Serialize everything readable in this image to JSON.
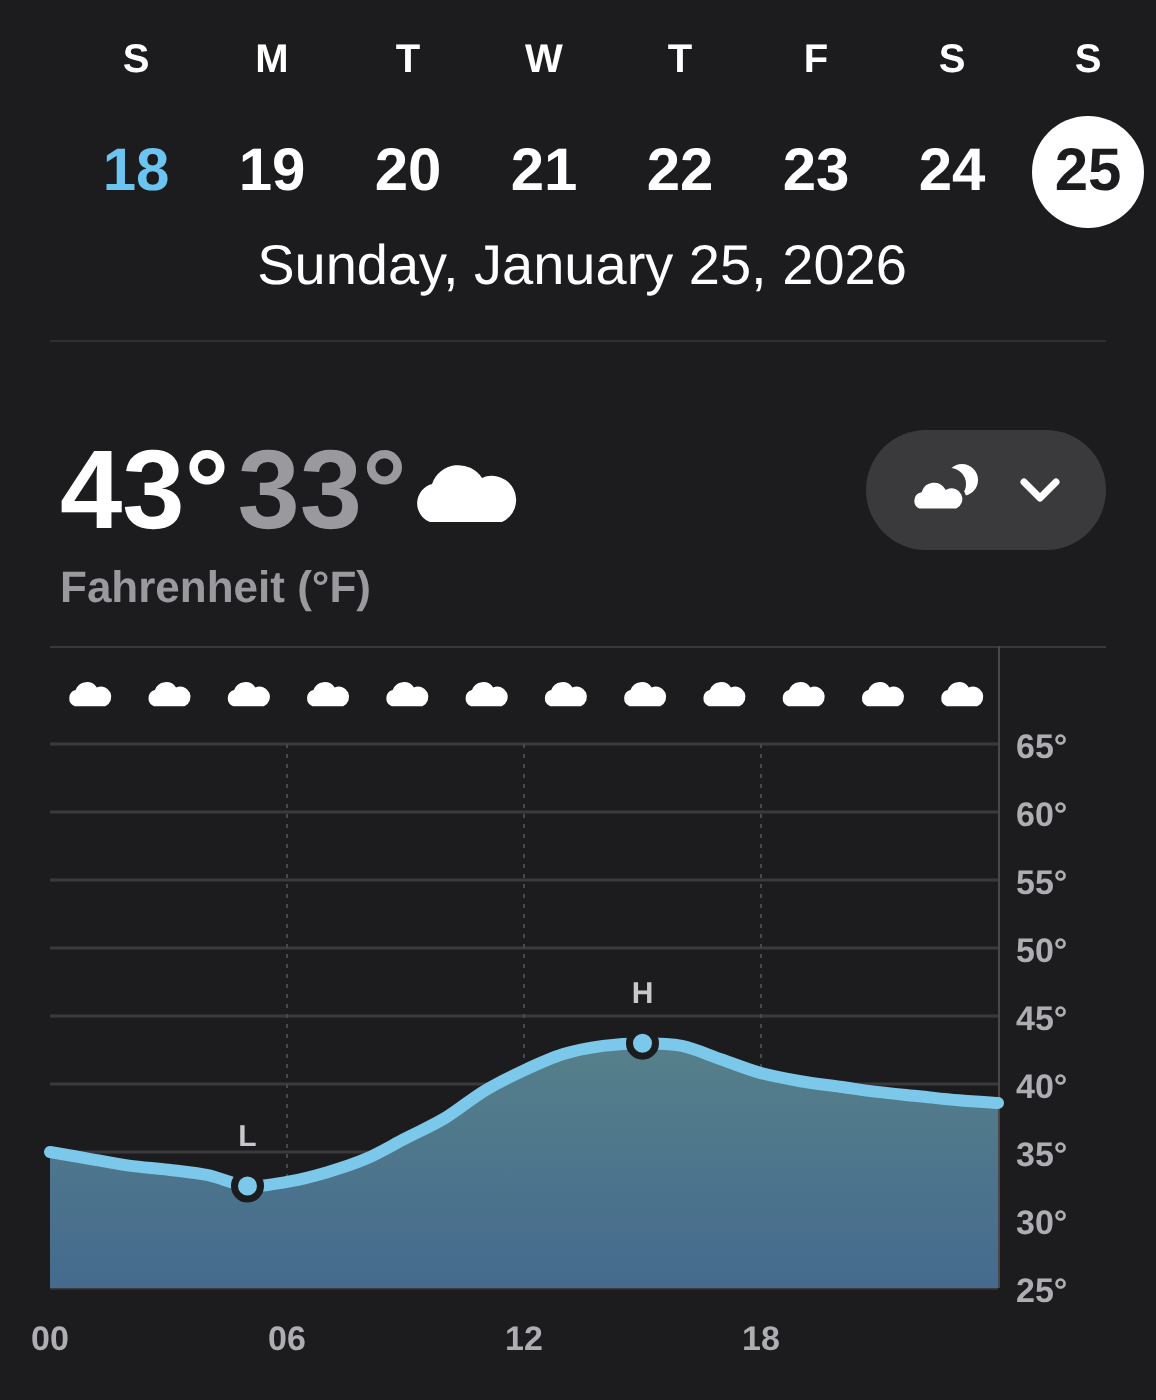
{
  "week": [
    {
      "letter": "S",
      "number": "18",
      "selected": false,
      "today": true
    },
    {
      "letter": "M",
      "number": "19",
      "selected": false,
      "today": false
    },
    {
      "letter": "T",
      "number": "20",
      "selected": false,
      "today": false
    },
    {
      "letter": "W",
      "number": "21",
      "selected": false,
      "today": false
    },
    {
      "letter": "T",
      "number": "22",
      "selected": false,
      "today": false
    },
    {
      "letter": "F",
      "number": "23",
      "selected": false,
      "today": false
    },
    {
      "letter": "S",
      "number": "24",
      "selected": false,
      "today": false
    },
    {
      "letter": "S",
      "number": "25",
      "selected": true,
      "today": false
    }
  ],
  "date_title": "Sunday, January 25, 2026",
  "summary": {
    "high": "43°",
    "low": "33°",
    "unit_label": "Fahrenheit (°F)"
  },
  "hourly_conditions": [
    {
      "kind": "cloud"
    },
    {
      "kind": "cloud"
    },
    {
      "kind": "cloud"
    },
    {
      "kind": "cloud"
    },
    {
      "kind": "cloud"
    },
    {
      "kind": "cloud"
    },
    {
      "kind": "cloud"
    },
    {
      "kind": "cloud"
    },
    {
      "kind": "cloud"
    },
    {
      "kind": "cloud"
    },
    {
      "kind": "cloud"
    },
    {
      "kind": "cloud"
    }
  ],
  "extremes": [
    {
      "kind": "low",
      "label": "L"
    },
    {
      "kind": "high",
      "label": "H"
    }
  ],
  "chart_data": {
    "type": "area",
    "x": [
      0,
      1,
      2,
      3,
      4,
      5,
      6,
      7,
      8,
      9,
      10,
      11,
      12,
      13,
      14,
      15,
      16,
      17,
      18,
      19,
      20,
      21,
      22,
      23,
      24
    ],
    "series": [
      {
        "color": "#7cc8ea",
        "values": [
          35,
          34.5,
          34,
          33.7,
          33.3,
          32.5,
          32.8,
          33.5,
          34.5,
          36,
          37.5,
          39.5,
          41,
          42.2,
          42.8,
          43,
          42.8,
          41.8,
          40.8,
          40.2,
          39.8,
          39.4,
          39.1,
          38.8,
          38.6
        ]
      }
    ],
    "xlim": [
      0,
      24
    ],
    "ylim": [
      25,
      65
    ],
    "grid": true,
    "xticks": [
      {
        "value": 0,
        "label": "00"
      },
      {
        "value": 6,
        "label": "06"
      },
      {
        "value": 12,
        "label": "12"
      },
      {
        "value": 18,
        "label": "18"
      }
    ],
    "yticks": [
      {
        "value": 25,
        "label": "25°"
      },
      {
        "value": 30,
        "label": "30°"
      },
      {
        "value": 35,
        "label": "35°"
      },
      {
        "value": 40,
        "label": "40°"
      },
      {
        "value": 45,
        "label": "45°"
      },
      {
        "value": 50,
        "label": "50°"
      },
      {
        "value": 55,
        "label": "55°"
      },
      {
        "value": 60,
        "label": "60°"
      },
      {
        "value": 65,
        "label": "65°"
      }
    ]
  }
}
